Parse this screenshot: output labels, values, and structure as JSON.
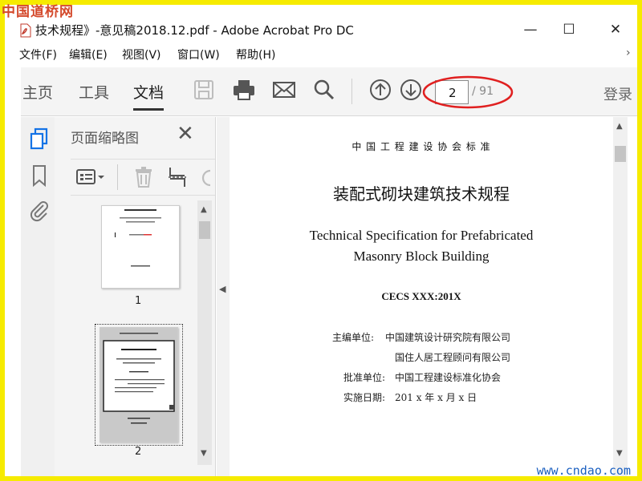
{
  "watermark": {
    "top_left": "中国道桥网",
    "bottom_right": "www.cndao.com"
  },
  "window": {
    "title": "技术规程》-意见稿2018.12.pdf - Adobe Acrobat Pro DC",
    "pdf_icon": "pdf-icon",
    "minimize": "—",
    "maximize": "☐",
    "close": "✕"
  },
  "menu": {
    "items": [
      "文件(F)",
      "编辑(E)",
      "视图(V)",
      "窗口(W)",
      "帮助(H)"
    ],
    "overflow": "›"
  },
  "toolbar": {
    "tabs": [
      "主页",
      "工具",
      "文档"
    ],
    "active_tab": "文档",
    "icons": [
      "save-icon",
      "print-icon",
      "mail-icon",
      "search-icon",
      "page-up-icon",
      "page-down-icon"
    ],
    "current_page": "2",
    "total_pages": "/ 91",
    "login": "登录",
    "highlight_color": "#e02020"
  },
  "rail": {
    "icons": [
      "page-thumbnails-icon",
      "bookmark-icon",
      "attachment-icon"
    ],
    "accent": "#1473e6"
  },
  "thumbnails_panel": {
    "title": "页面缩略图",
    "close": "✕",
    "tools": [
      "thumbnail-options-icon",
      "delete-page-icon",
      "crop-pages-icon",
      "rotate-icon"
    ],
    "pages": [
      {
        "label": "1"
      },
      {
        "label": "2"
      }
    ]
  },
  "document": {
    "association": "中 国 工 程 建 设 协 会 标 准",
    "title_cn": "装配式砌块建筑技术规程",
    "title_en_line1": "Technical Specification for Prefabricated",
    "title_en_line2": "Masonry Block Building",
    "code": "CECS XXX:201X",
    "chief_editor_label": "主编单位:",
    "chief_editor_1": "中国建筑设计研究院有限公司",
    "chief_editor_2": "国住人居工程顾问有限公司",
    "approval_label": "批准单位:",
    "approval_value": "中国工程建设标准化协会",
    "effective_label": "实施日期:",
    "effective_value": "201 x 年 x 月 x 日"
  }
}
